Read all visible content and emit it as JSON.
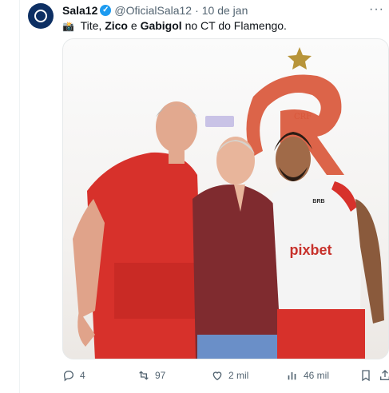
{
  "tweet": {
    "author_name": "Sala12",
    "handle": "@OficialSala12",
    "separator": "·",
    "date": "10 de jan",
    "text_emoji": "📸",
    "text_part1": "Tite,",
    "text_bold1": "Zico",
    "text_part2": "e",
    "text_bold2": "Gabigol",
    "text_part3": "no CT do Flamengo."
  },
  "photo": {
    "crest_letters": "CRF",
    "jersey_sponsor": "pixbet",
    "jersey_brand": "BRB"
  },
  "actions": {
    "replies": "4",
    "retweets": "97",
    "likes": "2 mil",
    "views": "46 mil"
  },
  "icons": {
    "reply": "reply-icon",
    "retweet": "retweet-icon",
    "like": "heart-icon",
    "views": "views-icon",
    "bookmark": "bookmark-icon",
    "share": "share-icon",
    "more": "more-icon",
    "verified": "verified-icon"
  },
  "colors": {
    "verified_blue": "#1d9bf0",
    "flamengo_red": "#d7312b",
    "muted_text": "#536471"
  }
}
